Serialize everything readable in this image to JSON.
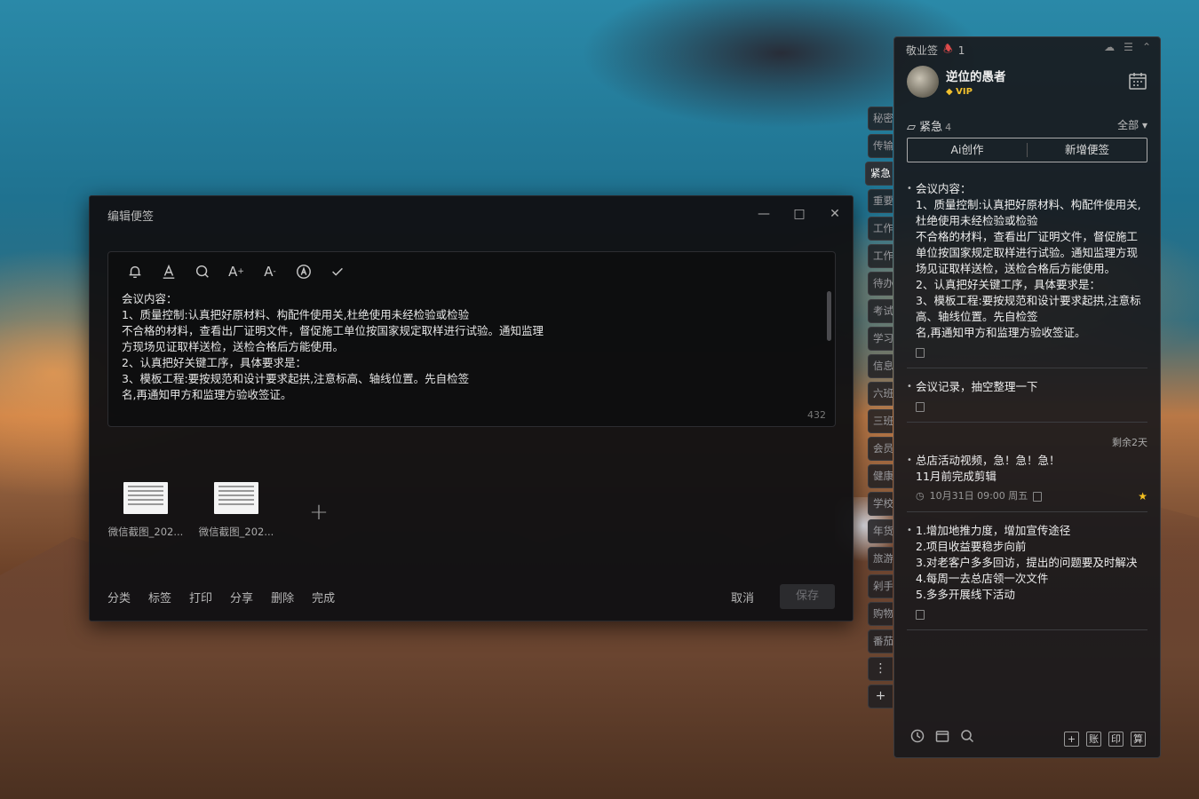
{
  "editor": {
    "title": "编辑便签",
    "content": "会议内容：\n1、质量控制:认真把好原材料、构配件使用关,杜绝使用未经检验或检验\n不合格的材料，查看出厂证明文件，督促施工单位按国家规定取样进行试验。通知监理\n方现场见证取样送检，送检合格后方能使用。\n2、认真把好关键工序，具体要求是：\n3、模板工程:要按规范和设计要求起拱,注意标高、轴线位置。先自检签\n名,再通知甲方和监理方验收签证。",
    "char_count": "432",
    "toolbar_icons": [
      "bell-icon",
      "font-color-icon",
      "search-icon",
      "font-larger-icon",
      "font-smaller-icon",
      "clear-format-icon",
      "check-icon"
    ],
    "attachments": [
      {
        "name": "微信截图_202..."
      },
      {
        "name": "微信截图_202..."
      }
    ],
    "actions": [
      "分类",
      "标签",
      "打印",
      "分享",
      "删除",
      "完成"
    ],
    "cancel_label": "取消",
    "save_label": "保存"
  },
  "side_tabs": [
    "秘密",
    "传输",
    "紧急",
    "重要",
    "工作",
    "工作",
    "待办",
    "考试",
    "学习",
    "信息",
    "六班",
    "三班",
    "会员",
    "健康",
    "学校",
    "年货",
    "旅游",
    "剁手",
    "购物",
    "番茄"
  ],
  "panel": {
    "app_name": "敬业签",
    "reminder_count": "1",
    "username": "逆位的愚者",
    "vip_label": "VIP",
    "category": "紧急",
    "category_count": "4",
    "filter_label": "全部",
    "ai_button": "Ai创作",
    "new_note_button": "新增便签",
    "notes": [
      {
        "text": "会议内容：\n1、质量控制:认真把好原材料、构配件使用关,杜绝使用未经检验或检验\n不合格的材料，查看出厂证明文件，督促施工单位按国家规定取样进行试验。通知监理方现场见证取样送检，送检合格后方能使用。\n2、认真把好关键工序，具体要求是：\n3、模板工程:要按规范和设计要求起拱,注意标高、轴线位置。先自检签\n名,再通知甲方和监理方验收签证。"
      },
      {
        "text": "会议记录，抽空整理一下"
      },
      {
        "text": "总店活动视频，急！急！急！\n11月前完成剪辑",
        "remaining": "剩余2天",
        "reminder": "10月31日 09:00 周五",
        "starred": true
      },
      {
        "text": "1.增加地推力度，增加宣传途径\n2.项目收益要稳步向前\n3.对老客户多多回访，提出的问题要及时解决\n4.每周一去总店领一次文件\n5.多多开展线下活动"
      }
    ],
    "bottom_buttons": [
      "账",
      "印",
      "算"
    ]
  }
}
